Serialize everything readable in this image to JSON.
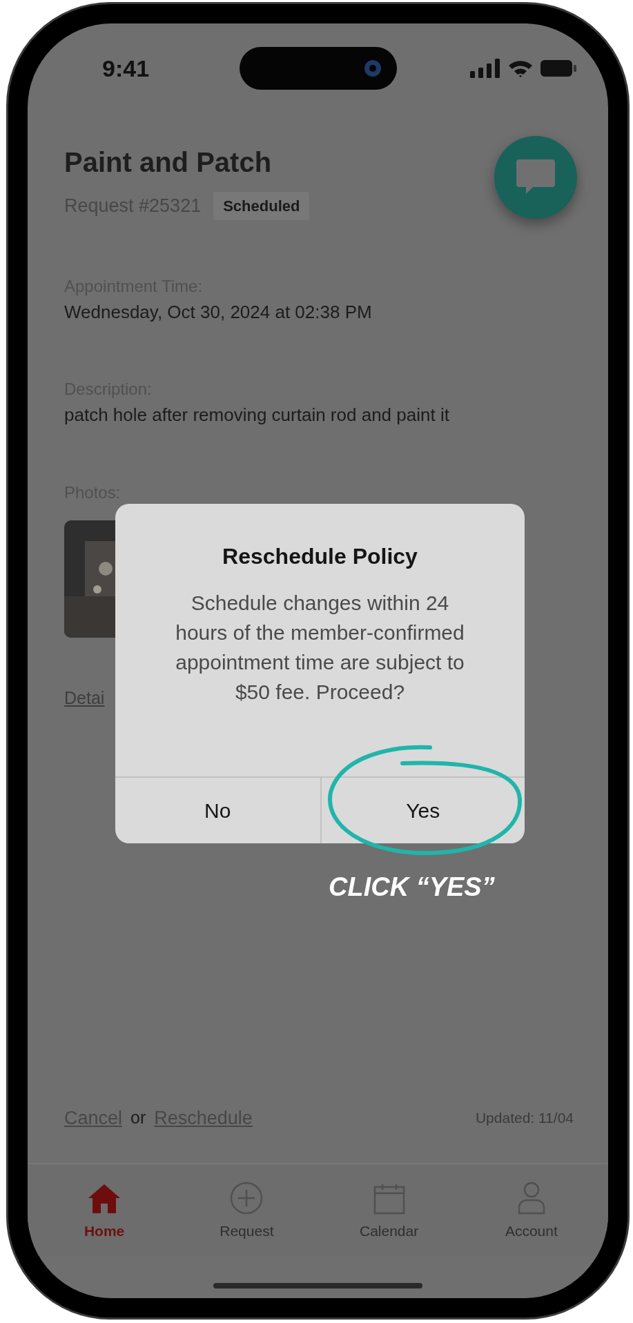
{
  "status_bar": {
    "time": "9:41"
  },
  "request": {
    "title": "Paint and Patch",
    "number": "Request #25321",
    "status": "Scheduled"
  },
  "fields": [
    {
      "label": "Appointment Time:",
      "value": "Wednesday, Oct 30, 2024 at 02:38 PM"
    },
    {
      "label": "Description:",
      "value": "patch hole after removing curtain rod and paint it"
    }
  ],
  "photos": {
    "label": "Photos:"
  },
  "details_link": "Detai",
  "dialog": {
    "title": "Reschedule Policy",
    "message": "Schedule changes within 24 hours of the member-confirmed appointment time are subject to $50 fee. Proceed?",
    "buttons": [
      {
        "label": "No"
      },
      {
        "label": "Yes"
      }
    ]
  },
  "annotation": {
    "text": "CLICK “YES”"
  },
  "footer": {
    "cancel": "Cancel",
    "separator": "or",
    "reschedule": "Reschedule",
    "updated": "Updated: 11/04"
  },
  "tabs": [
    {
      "label": "Home",
      "kind": "home",
      "selected": true
    },
    {
      "label": "Request",
      "kind": "add",
      "selected": false
    },
    {
      "label": "Calendar",
      "kind": "calendar",
      "selected": false
    },
    {
      "label": "Account",
      "kind": "account",
      "selected": false
    }
  ]
}
